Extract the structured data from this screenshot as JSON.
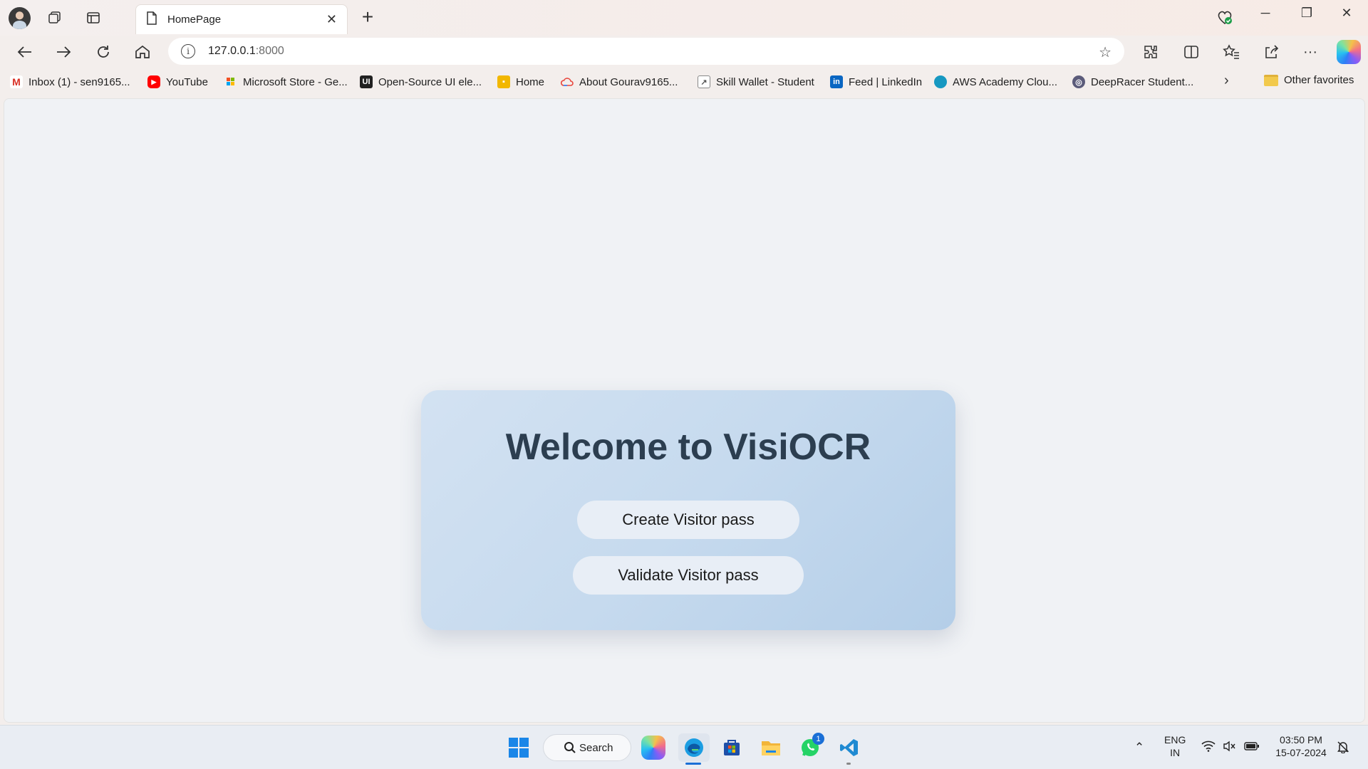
{
  "browser": {
    "tab_title": "HomePage",
    "new_tab_symbol": "+",
    "address_host": "127.0.0.1",
    "address_port": ":8000"
  },
  "bookmarks": [
    {
      "label": "Inbox (1) - sen9165...",
      "icon": "gmail-icon"
    },
    {
      "label": "YouTube",
      "icon": "youtube-icon"
    },
    {
      "label": "Microsoft Store - Ge...",
      "icon": "microsoft-icon"
    },
    {
      "label": "Open-Source UI ele...",
      "icon": "uiverse-icon"
    },
    {
      "label": "Home",
      "icon": "classroom-icon"
    },
    {
      "label": "About Gourav9165...",
      "icon": "cloud-icon"
    },
    {
      "label": "Skill Wallet - Student",
      "icon": "skillwallet-icon"
    },
    {
      "label": "Feed | LinkedIn",
      "icon": "linkedin-icon"
    },
    {
      "label": "AWS Academy Clou...",
      "icon": "salesforce-icon"
    },
    {
      "label": "DeepRacer Student...",
      "icon": "deepracer-icon"
    }
  ],
  "other_favorites": "Other favorites",
  "page": {
    "title": "Welcome to VisiOCR",
    "create_button": "Create Visitor pass",
    "validate_button": "Validate Visitor pass"
  },
  "taskbar": {
    "search_label": "Search",
    "whatsapp_badge": "1",
    "language_line1": "ENG",
    "language_line2": "IN",
    "time": "03:50 PM",
    "date": "15-07-2024"
  },
  "colors": {
    "card_title": "#2c3e50",
    "accent": "#1a6fd6"
  }
}
